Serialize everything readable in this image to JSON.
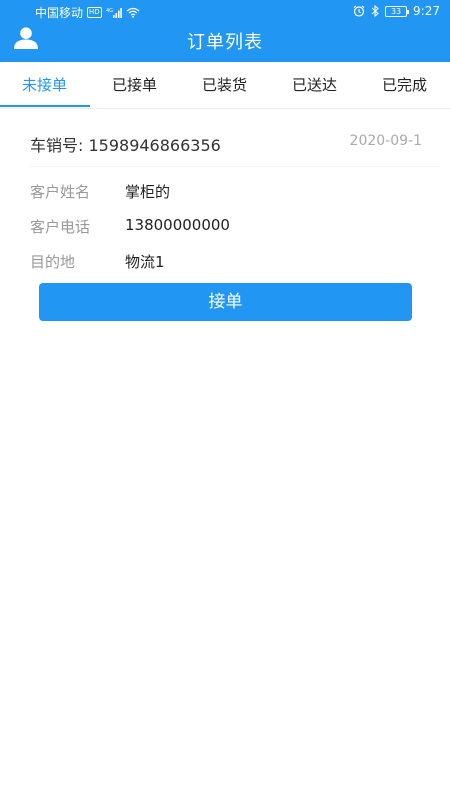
{
  "status_bar": {
    "carrier": "中国移动",
    "hd_badge": "HD",
    "network": "4G",
    "battery": "33",
    "time": "9:27"
  },
  "header": {
    "title": "订单列表",
    "user_icon": "user-icon"
  },
  "tabs": [
    {
      "label": "未接单",
      "active": true
    },
    {
      "label": "已接单",
      "active": false
    },
    {
      "label": "已装货",
      "active": false
    },
    {
      "label": "已送达",
      "active": false
    },
    {
      "label": "已完成",
      "active": false
    }
  ],
  "order": {
    "car_label": "车销号: 1598946866356",
    "date": "2020-09-1",
    "fields": [
      {
        "key": "客户姓名",
        "value": "掌柜的"
      },
      {
        "key": "客户电话",
        "value": "13800000000"
      },
      {
        "key": "目的地",
        "value": "物流1"
      }
    ],
    "accept_button": "接单"
  },
  "colors": {
    "primary": "#2196f3",
    "text": "#222222",
    "muted": "#999999",
    "date": "#aaaaaa"
  }
}
